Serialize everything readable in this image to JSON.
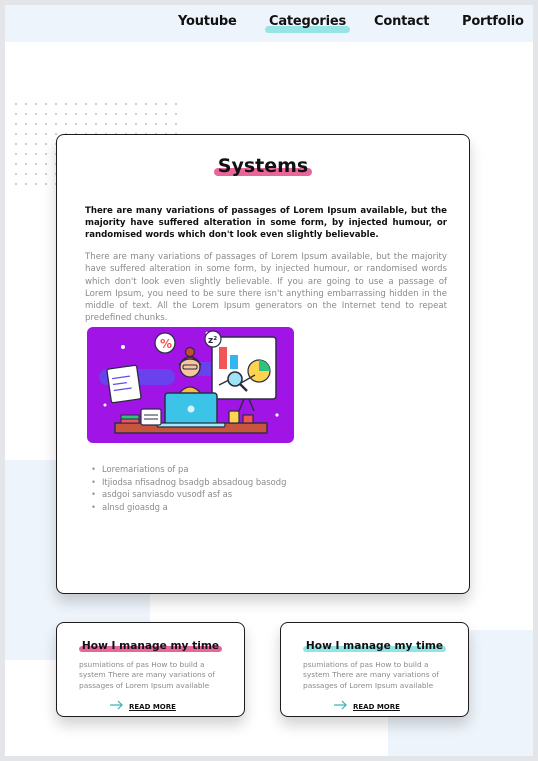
{
  "nav": {
    "items": [
      {
        "label": "Youtube"
      },
      {
        "label": "Categories"
      },
      {
        "label": "Contact"
      },
      {
        "label": "Portfolio"
      }
    ],
    "active": "Categories"
  },
  "main": {
    "title": "Systems",
    "lead": "There are many variations of passages of Lorem Ipsum available, but the majority have suffered alteration in some form, by injected humour, or randomised words which don't look even slightly believable.",
    "body": "There are many variations of passages of Lorem Ipsum available, but the majority have suffered alteration in some form, by injected humour, or randomised words which don't look even slightly believable. If you are going to use a passage of Lorem Ipsum, you need to be sure there isn't anything embarrassing hidden in the middle of text. All the Lorem Ipsum generators on the Internet tend to repeat predefined chunks.",
    "bullets": [
      "Loremariations of pa",
      "Itjiodsa nfisadnog bsadgb absadoug basodg",
      "asdgoi sanviasdo vusodf asf as",
      "alnsd gioasdg a"
    ]
  },
  "cards": [
    {
      "title": "How I manage my time",
      "text": "psumiations of pas How to build a system There are many variations of passages of Lorem Ipsum available",
      "link": "READ MORE"
    },
    {
      "title": "How I manage my time",
      "text": "psumiations of pas How to build a system There are many variations of passages of Lorem Ipsum available",
      "link": "READ MORE"
    }
  ],
  "colors": {
    "accent_pink": "#e54b8a",
    "accent_teal": "#7fe0e0",
    "illustration_bg": "#a014e6",
    "pale_blue": "#eef4fb"
  },
  "icons": {
    "read_more": "arrow-right-icon"
  }
}
